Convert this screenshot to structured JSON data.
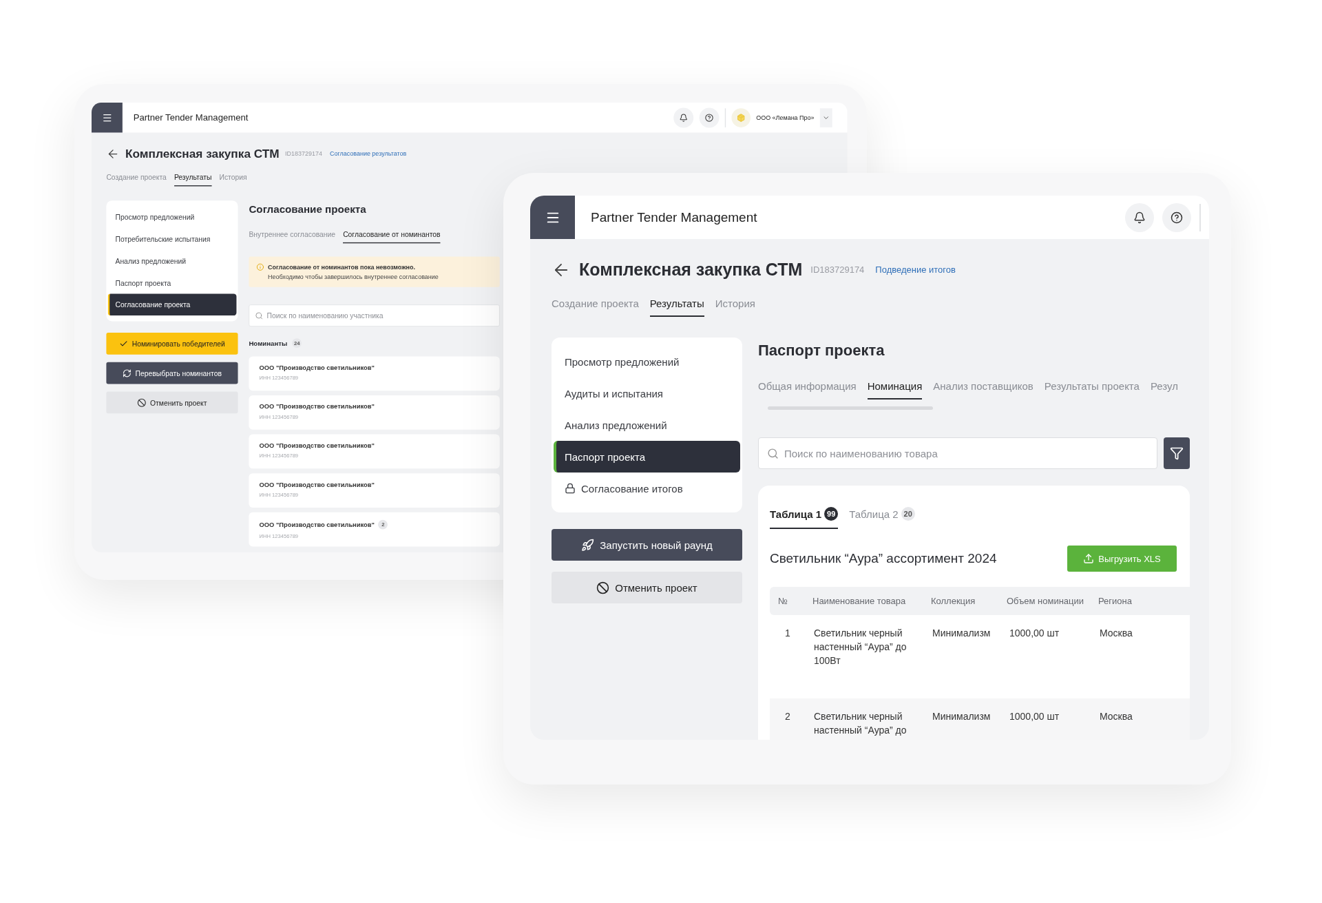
{
  "back_window": {
    "header": {
      "title": "Partner Tender Management",
      "company": "ООО «Лемана Про»"
    },
    "project": {
      "title": "Комплексная закупка СТМ",
      "id": "ID183729174",
      "status": "Согласование результатов"
    },
    "tabs": [
      {
        "label": "Создание проекта",
        "selected": false
      },
      {
        "label": "Результаты",
        "selected": true
      },
      {
        "label": "История",
        "selected": false
      }
    ],
    "sidebar": [
      {
        "label": "Просмотр предложений",
        "selected": false,
        "locked": false
      },
      {
        "label": "Потребительские испытания",
        "selected": false,
        "locked": false
      },
      {
        "label": "Анализ предложений",
        "selected": false,
        "locked": false
      },
      {
        "label": "Паспорт проекта",
        "selected": false,
        "locked": false
      },
      {
        "label": "Согласование проекта",
        "selected": true,
        "locked": false
      }
    ],
    "actions": [
      {
        "label": "Номинировать победителей",
        "kind": "nominate"
      },
      {
        "label": "Перевыбрать номинантов",
        "kind": "reselect"
      },
      {
        "label": "Отменить проект",
        "kind": "cancel"
      }
    ],
    "section": {
      "title": "Согласование проекта",
      "subtabs": [
        {
          "label": "Внутреннее согласование",
          "selected": false
        },
        {
          "label": "Согласование от номинантов",
          "selected": true
        }
      ],
      "alert": {
        "title": "Согласование от номинантов пока невозможно.",
        "text": "Необходимо чтобы завершилось внутреннее согласование"
      },
      "search": {
        "placeholder": "Поиск по наименованию участника"
      },
      "nominees": {
        "label": "Номинанты",
        "count": "24",
        "items": [
          {
            "name": "ООО \"Производство светильников\"",
            "inn": "ИНН 123456789"
          },
          {
            "name": "ООО \"Производство светильников\"",
            "inn": "ИНН 123456789"
          },
          {
            "name": "ООО \"Производство светильников\"",
            "inn": "ИНН 123456789"
          },
          {
            "name": "ООО \"Производство светильников\"",
            "inn": "ИНН 123456789"
          },
          {
            "name": "ООО \"Производство светильников\"",
            "inn": "ИНН 123456789",
            "badge": "2"
          }
        ]
      }
    }
  },
  "front_window": {
    "header": {
      "title": "Partner Tender Management"
    },
    "project": {
      "title": "Комплексная закупка СТМ",
      "id": "ID183729174",
      "status": "Подведение итогов"
    },
    "tabs": [
      {
        "label": "Создание проекта",
        "selected": false
      },
      {
        "label": "Результаты",
        "selected": true
      },
      {
        "label": "История",
        "selected": false
      }
    ],
    "sidebar": [
      {
        "label": "Просмотр предложений",
        "selected": false,
        "locked": false
      },
      {
        "label": "Аудиты и испытания",
        "selected": false,
        "locked": false
      },
      {
        "label": "Анализ предложений",
        "selected": false,
        "locked": false
      },
      {
        "label": "Паспорт проекта",
        "selected": true,
        "locked": false
      },
      {
        "label": "Согласование итогов",
        "selected": false,
        "locked": true
      }
    ],
    "actions": [
      {
        "label": "Запустить новый раунд",
        "kind": "launch"
      },
      {
        "label": "Отменить проект",
        "kind": "cancel"
      }
    ],
    "section": {
      "title": "Паспорт проекта",
      "subtabs": [
        {
          "label": "Общая информация",
          "selected": false
        },
        {
          "label": "Номинация",
          "selected": true
        },
        {
          "label": "Анализ поставщиков",
          "selected": false
        },
        {
          "label": "Результаты проекта",
          "selected": false
        },
        {
          "label": "Резул",
          "selected": false
        }
      ],
      "search": {
        "placeholder": "Поиск по наименованию товара"
      },
      "table_tabs": [
        {
          "label": "Таблица 1",
          "count": "99",
          "selected": true
        },
        {
          "label": "Таблица 2",
          "count": "20",
          "selected": false
        }
      ],
      "table_title": "Светильник “Аура” ассортимент 2024",
      "export_button": "Выгрузить XLS",
      "table": {
        "columns": [
          "№",
          "Наименование товара",
          "Коллекция",
          "Объем номинации",
          "Региона"
        ],
        "rows": [
          [
            "1",
            "Светильник черный настенный “Аура” до 100Вт",
            "Минимализм",
            "1000,00 шт",
            "Москва"
          ],
          [
            "2",
            "Светильник черный настенный “Аура” до",
            "Минимализм",
            "1000,00 шт",
            "Москва"
          ]
        ]
      }
    }
  }
}
